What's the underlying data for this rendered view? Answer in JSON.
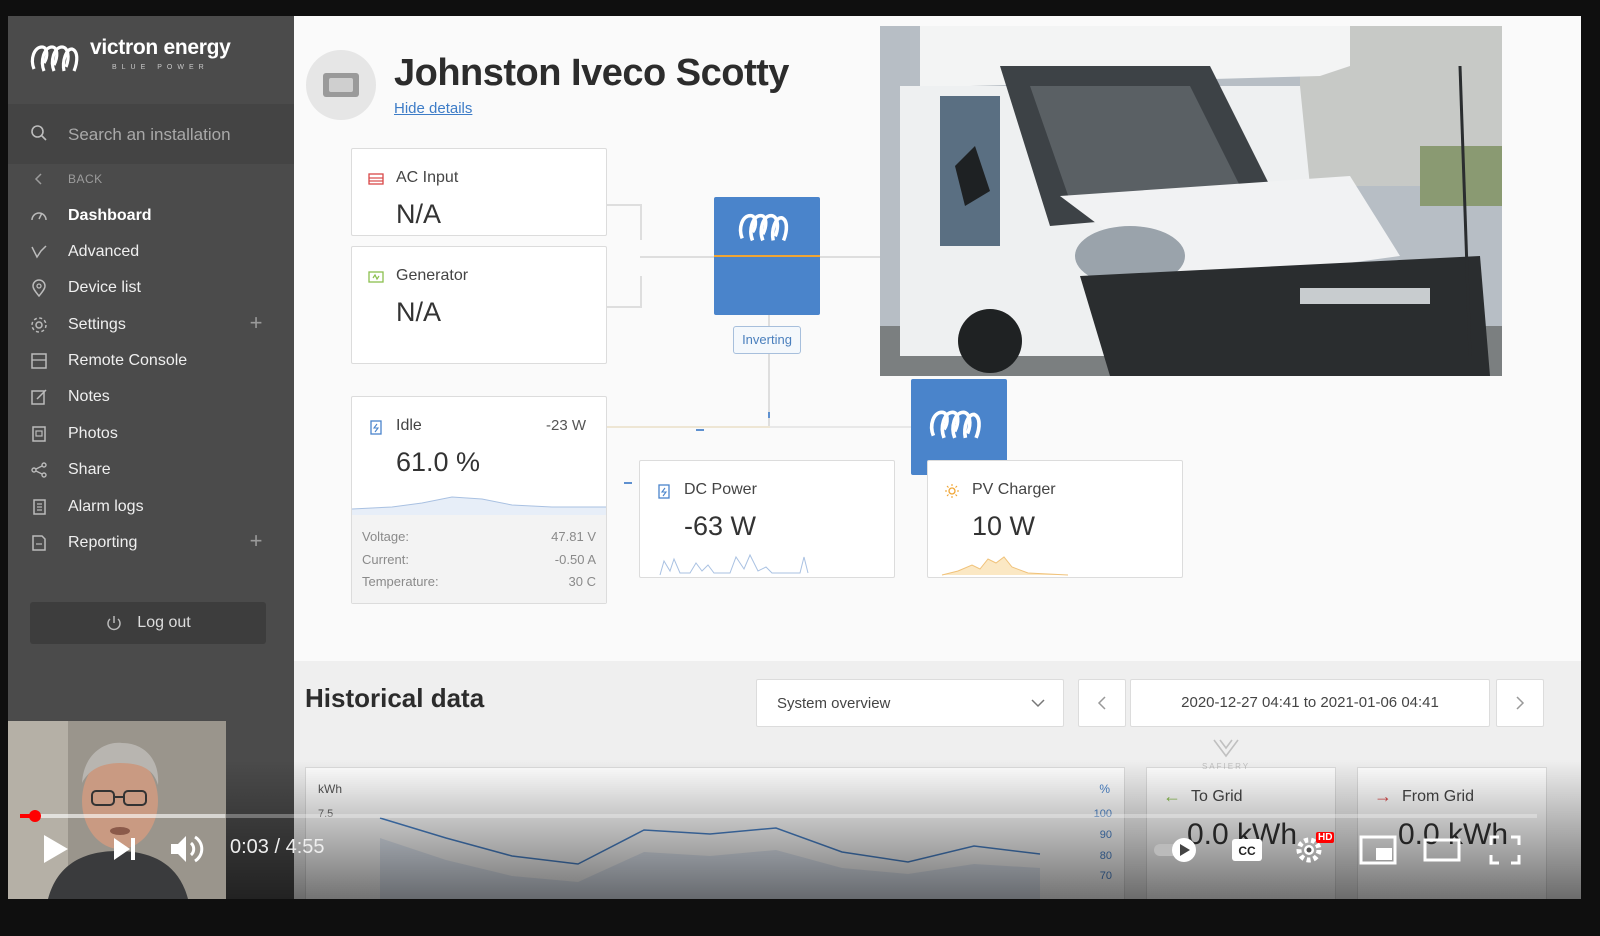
{
  "sidebar": {
    "brand": "victron energy",
    "brand_tagline": "BLUE POWER",
    "search_placeholder": "Search an installation",
    "back_label": "BACK",
    "items": [
      {
        "label": "Dashboard",
        "icon": "gauge-icon",
        "active": true
      },
      {
        "label": "Advanced",
        "icon": "graph-icon"
      },
      {
        "label": "Device list",
        "icon": "location-pin-icon"
      },
      {
        "label": "Settings",
        "icon": "gear-icon",
        "expandable": true
      },
      {
        "label": "Remote Console",
        "icon": "console-icon"
      },
      {
        "label": "Notes",
        "icon": "notes-icon"
      },
      {
        "label": "Photos",
        "icon": "photo-icon"
      },
      {
        "label": "Share",
        "icon": "share-icon"
      },
      {
        "label": "Alarm logs",
        "icon": "alarm-log-icon"
      },
      {
        "label": "Reporting",
        "icon": "report-icon",
        "expandable": true
      }
    ],
    "logout_label": "Log out"
  },
  "header": {
    "title": "Johnston Iveco Scotty",
    "hide_details": "Hide details"
  },
  "cards": {
    "ac_input": {
      "label": "AC Input",
      "value": "N/A"
    },
    "generator": {
      "label": "Generator",
      "value": "N/A"
    },
    "battery": {
      "state": "Idle",
      "power": "-23 W",
      "soc": "61.0 %",
      "details": [
        {
          "label": "Voltage:",
          "value": "47.81 V"
        },
        {
          "label": "Current:",
          "value": "-0.50 A"
        },
        {
          "label": "Temperature:",
          "value": "30 C"
        }
      ]
    },
    "dc_power": {
      "label": "DC Power",
      "value": "-63 W"
    },
    "pv_charger": {
      "label": "PV Charger",
      "value": "10 W"
    },
    "inverter_state": "Inverting"
  },
  "historical": {
    "title": "Historical data",
    "view_select": "System overview",
    "date_range": "2020-12-27 04:41 to 2021-01-06 04:41",
    "chart_unit_left": "kWh",
    "chart_unit_right": "%",
    "left_ticks": [
      "7.5"
    ],
    "right_ticks": [
      "100",
      "90",
      "80",
      "70"
    ],
    "to_grid": {
      "label": "To Grid",
      "value": "0.0 kWh"
    },
    "from_grid": {
      "label": "From Grid",
      "value": "0.0 kWh"
    }
  },
  "watermark": "SAFIERY",
  "player": {
    "current_time": "0:03",
    "duration": "4:55",
    "time_display": "0:03 / 4:55",
    "played_fraction": 0.01,
    "hd_badge": "HD",
    "accent_color": "#ff0000"
  },
  "colors": {
    "sidebar_bg": "#4b4b4b",
    "victron_blue": "#4a84cb",
    "link": "#3d7cc7"
  }
}
